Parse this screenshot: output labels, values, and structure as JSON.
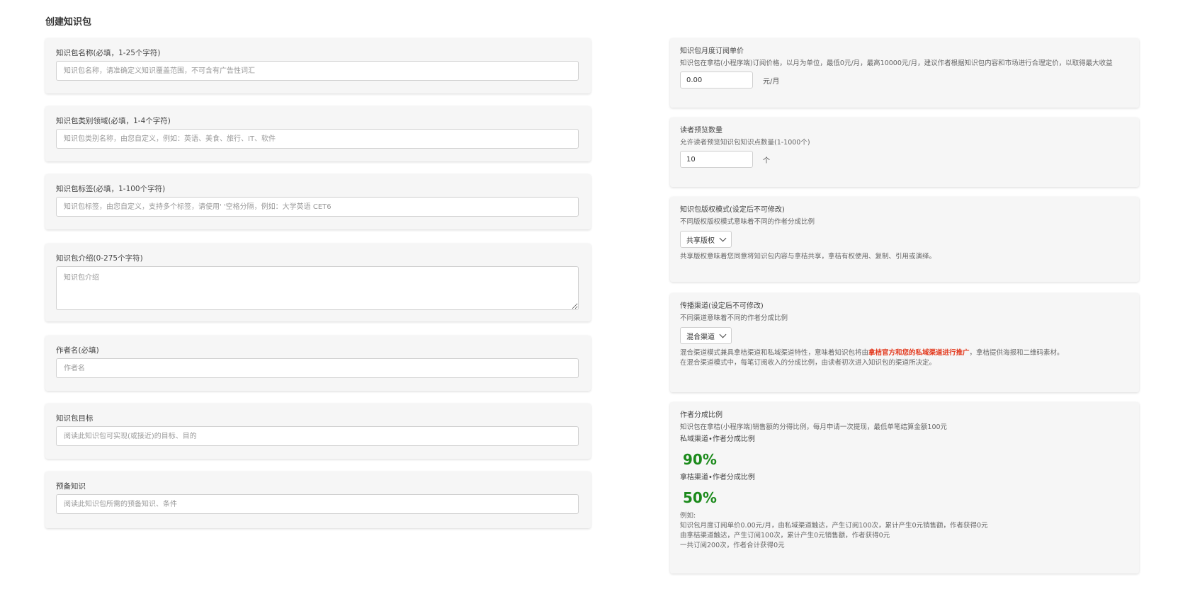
{
  "page_title": "创建知识包",
  "left": {
    "name": {
      "label": "知识包名称(必填，1-25个字符)",
      "placeholder": "知识包名称，请准确定义知识覆盖范围，不可含有广告性词汇"
    },
    "category": {
      "label": "知识包类别领域(必填，1-4个字符)",
      "placeholder": "知识包类别名称，由您自定义，例如：英语、美食、旅行、IT、软件"
    },
    "tags": {
      "label": "知识包标签(必填，1-100个字符)",
      "placeholder": "知识包标签，由您自定义，支持多个标签，请使用' '空格分隔，例如：大学英语 CET6"
    },
    "intro": {
      "label": "知识包介绍(0-275个字符)",
      "placeholder": "知识包介绍"
    },
    "author": {
      "label": "作者名(必填)",
      "placeholder": "作者名"
    },
    "goal": {
      "label": "知识包目标",
      "placeholder": "阅读此知识包可实现(或接近)的目标、目的"
    },
    "prereq": {
      "label": "预备知识",
      "placeholder": "阅读此知识包所需的预备知识、条件"
    }
  },
  "right": {
    "price": {
      "label": "知识包月度订阅单价",
      "hint": "知识包在拿桔(小程序端)订阅价格，以月为单位，最低0元/月，最高10000元/月，建议作者根据知识包内容和市场进行合理定价，以取得最大收益",
      "value": "0.00",
      "unit": "元/月"
    },
    "preview": {
      "label": "读者预览数量",
      "hint": "允许读者预览知识包知识点数量(1-1000个)",
      "value": "10",
      "unit": "个"
    },
    "copyright": {
      "label": "知识包版权模式(设定后不可修改)",
      "hint": "不同版权版权模式意味着不同的作者分成比例",
      "selected": "共享版权",
      "desc": "共享版权意味着您同意将知识包内容与拿桔共享，拿桔有权使用、复制、引用或演绎。"
    },
    "channel": {
      "label": "传播渠道(设定后不可修改)",
      "hint": "不同渠道意味着不同的作者分成比例",
      "selected": "混合渠道",
      "desc_pre": "混合渠道模式兼具拿桔渠道和私域渠道特性，意味着知识包将由",
      "desc_highlight": "拿桔官方和您的私域渠道进行推广",
      "desc_post": "，拿桔提供海报和二维码素材。",
      "desc2": "在混合渠道模式中，每笔订阅收入的分成比例，由读者初次进入知识包的渠道所决定。"
    },
    "share": {
      "label": "作者分成比例",
      "hint": "知识包在拿桔(小程序端)销售额的分得比例，每月申请一次提现，最低单笔结算金额100元",
      "private_label": "私域渠道•作者分成比例",
      "private_pct": "90%",
      "najie_label": "拿桔渠道•作者分成比例",
      "najie_pct": "50%",
      "example_title": "例如:",
      "example_1": "知识包月度订阅单价0.00元/月，由私域渠道触达，产生订阅100次，累计产生0元销售额，作者获得0元",
      "example_2": "由拿桔渠道触达，产生订阅100次，累计产生0元销售额，作者获得0元",
      "example_3": "一共订阅200次，作者合计获得0元"
    }
  },
  "colors": {
    "accent_green": "#1b8a1b",
    "highlight_red": "#e33a1f",
    "card_bg": "#f6f6f6"
  }
}
